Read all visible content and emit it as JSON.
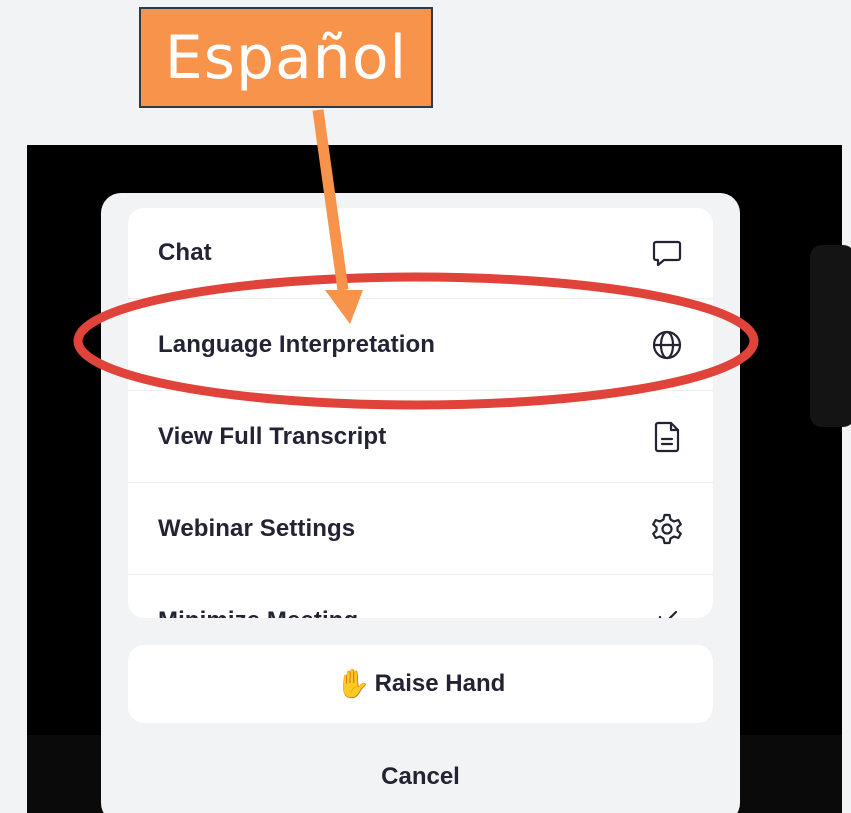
{
  "annotation": {
    "callout_text": "Español",
    "callout_color": "#f7934a",
    "highlight_color": "#e0433a",
    "arrow_color": "#f7934a"
  },
  "menu": {
    "items": [
      {
        "label": "Chat",
        "icon": "chat-bubble-icon"
      },
      {
        "label": "Language Interpretation",
        "icon": "globe-icon"
      },
      {
        "label": "View Full Transcript",
        "icon": "document-icon"
      },
      {
        "label": "Webinar Settings",
        "icon": "gear-icon"
      },
      {
        "label": "Minimize Meeting",
        "icon": "minimize-arrow-icon"
      }
    ]
  },
  "raise_hand": {
    "emoji": "✋",
    "label": "Raise Hand"
  },
  "cancel": {
    "label": "Cancel"
  }
}
